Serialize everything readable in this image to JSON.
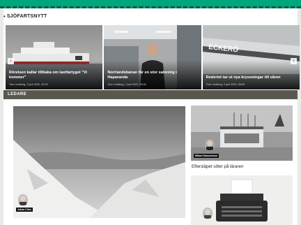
{
  "sections": {
    "news_header": "SJÖFARTSNYTT",
    "opinion_header": "LEDARE"
  },
  "news": [
    {
      "headline": "Rörelsen kallar tillbaka om lastfartyget \"Vi kommer\"",
      "meta": "Tore Lindberg, 2 juni 2022, 10:15"
    },
    {
      "headline": "Norrlandsbanan får en stor satsning i Haparanda",
      "meta": "Tore Lindberg, 2 juni 2022, 09:40"
    },
    {
      "headline": "Rederiet tar ut nya kryssningar till våren",
      "meta": "Tore Lindberg, 2 juni 2022, 08:05"
    }
  ],
  "opinion": {
    "main_author": "Johan Cline",
    "side_author": "Mikael Samuelsson",
    "side_caption": "Eftersläpet sitter på läraren"
  },
  "icons": {
    "nav_left": "‹",
    "nav_right": "›"
  },
  "colors": {
    "top_band": "#00a67c",
    "opinion_bar": "#5a574f"
  }
}
